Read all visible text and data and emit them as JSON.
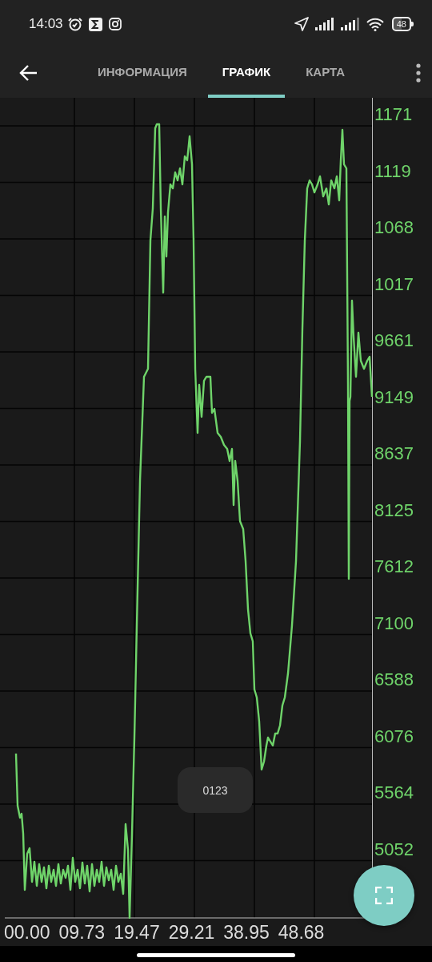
{
  "status_bar": {
    "time": "14:03",
    "battery": "48"
  },
  "app_bar": {
    "tabs": [
      {
        "label": "ИНФОРМАЦИЯ",
        "selected": false
      },
      {
        "label": "ГРАФИК",
        "selected": true
      },
      {
        "label": "КАРТА",
        "selected": false
      }
    ]
  },
  "chart": {
    "y_axis_labels": [
      "1171",
      "1119",
      "1068",
      "1017",
      "9661",
      "9149",
      "8637",
      "8125",
      "7612",
      "7100",
      "6588",
      "6076",
      "5564",
      "5052"
    ],
    "x_axis_labels": [
      "00.00",
      "09.73",
      "19.47",
      "29.21",
      "38.95",
      "48.68"
    ]
  },
  "toast": {
    "text": "0123"
  }
}
